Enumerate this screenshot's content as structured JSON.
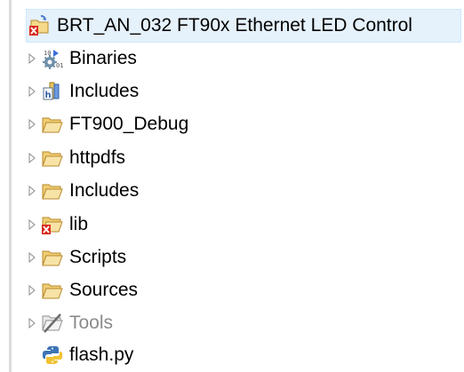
{
  "project_explorer": {
    "root": {
      "label": "BRT_AN_032 FT90x Ethernet LED Control",
      "icon": "project-error-icon"
    },
    "items": [
      {
        "label": "Binaries",
        "icon": "binaries-icon",
        "expandable": true,
        "dimmed": false
      },
      {
        "label": "Includes",
        "icon": "includes-library-icon",
        "expandable": true,
        "dimmed": false
      },
      {
        "label": "FT900_Debug",
        "icon": "folder-icon",
        "expandable": true,
        "dimmed": false
      },
      {
        "label": "httpdfs",
        "icon": "folder-icon",
        "expandable": true,
        "dimmed": false
      },
      {
        "label": "Includes",
        "icon": "folder-icon",
        "expandable": true,
        "dimmed": false
      },
      {
        "label": "lib",
        "icon": "folder-error-icon",
        "expandable": true,
        "dimmed": false
      },
      {
        "label": "Scripts",
        "icon": "folder-icon",
        "expandable": true,
        "dimmed": false
      },
      {
        "label": "Sources",
        "icon": "folder-icon",
        "expandable": true,
        "dimmed": false
      },
      {
        "label": "Tools",
        "icon": "excluded-folder-icon",
        "expandable": true,
        "dimmed": true
      },
      {
        "label": "flash.py",
        "icon": "python-file-icon",
        "expandable": false,
        "dimmed": false
      }
    ]
  },
  "colors": {
    "selection_bg": "#e5f1fb",
    "selection_border": "#cde8ff",
    "folder_fill": "#f5d98b",
    "folder_stroke": "#b8892d",
    "error_red": "#d9261c",
    "dim_text": "#8a8a8a"
  }
}
